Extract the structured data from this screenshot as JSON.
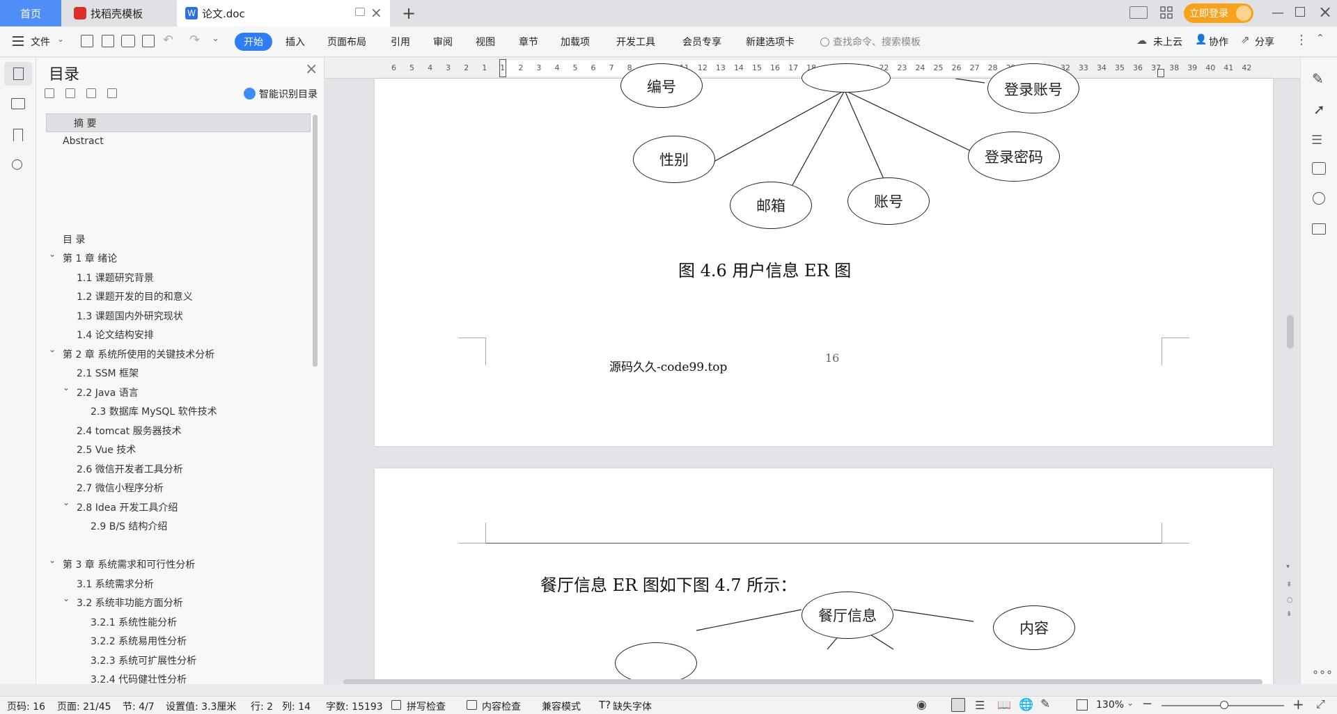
{
  "tabs": {
    "home": "首页",
    "template": "找稻壳模板",
    "doc": "论文.doc",
    "login": "立即登录"
  },
  "menu": {
    "file": "文件",
    "items": [
      "开始",
      "插入",
      "页面布局",
      "引用",
      "审阅",
      "视图",
      "章节",
      "加载项",
      "开发工具",
      "会员专享",
      "新建选项卡"
    ],
    "search_placeholder": "查找命令、搜索模板",
    "cloud": "未上云",
    "collab": "协作",
    "share": "分享"
  },
  "outline": {
    "title": "目录",
    "smart": "智能识别目录",
    "items": [
      {
        "label": "摘  要"
      },
      {
        "label": "Abstract"
      },
      {
        "label": "目  录"
      },
      {
        "label": "第 1 章  绪论"
      },
      {
        "label": "1.1    课题研究背景"
      },
      {
        "label": "1.2  课题开发的目的和意义"
      },
      {
        "label": "1.3    课题国内外研究现状"
      },
      {
        "label": "1.4  论文结构安排"
      },
      {
        "label": "第 2 章  系统所使用的关键技术分析"
      },
      {
        "label": "2.1 SSM 框架"
      },
      {
        "label": "2.2 Java 语言"
      },
      {
        "label": "2.3  数据库 MySQL 软件技术"
      },
      {
        "label": "2.4 tomcat 服务器技术"
      },
      {
        "label": "2.5 Vue 技术"
      },
      {
        "label": "2.6  微信开发者工具分析"
      },
      {
        "label": "2.7 微信小程序分析"
      },
      {
        "label": "2.8 Idea 开发工具介绍"
      },
      {
        "label": "2.9 B/S 结构介绍"
      },
      {
        "label": "第 3 章  系统需求和可行性分析"
      },
      {
        "label": "3.1 系统需求分析"
      },
      {
        "label": "3.2 系统非功能方面分析"
      },
      {
        "label": "3.2.1 系统性能分析"
      },
      {
        "label": "3.2.2 系统易用性分析"
      },
      {
        "label": "3.2.3 系统可扩展性分析"
      },
      {
        "label": "3.2.4 代码健壮性分析"
      }
    ]
  },
  "ruler": {
    "ticks": [
      "6",
      "5",
      "4",
      "3",
      "2",
      "1",
      "1",
      "2",
      "3",
      "4",
      "5",
      "6",
      "7",
      "8",
      "9",
      "10",
      "11",
      "12",
      "13",
      "14",
      "15",
      "16",
      "17",
      "18",
      "19",
      "20",
      "21",
      "22",
      "23",
      "24",
      "25",
      "26",
      "27",
      "28",
      "29",
      "30",
      "31",
      "32",
      "33",
      "34",
      "35",
      "36",
      "37",
      "38",
      "39",
      "40",
      "41",
      "42"
    ]
  },
  "page1": {
    "nodes": {
      "no": "编号",
      "account_login": "登录账号",
      "gender": "性别",
      "password": "登录密码",
      "email": "邮箱",
      "account": "账号"
    },
    "caption": "图 4.6 用户信息 ER 图",
    "footer_left": "源码久久-code99.top",
    "page_number": "16"
  },
  "page2": {
    "text": "餐厅信息 ER 图如下图 4.7 所示：",
    "nodes": {
      "center": "餐厅信息",
      "content": "内容"
    }
  },
  "status": {
    "page": "页码: 16",
    "pages": "页面: 21/45",
    "section": "节: 4/7",
    "setting": "设置值: 3.3厘米",
    "row": "行: 2",
    "col": "列: 14",
    "words": "字数: 15193",
    "spell": "拼写检查",
    "content_check": "内容检查",
    "compat": "兼容模式",
    "missing_font": "缺失字体",
    "zoom": "130%"
  },
  "colors": {
    "accent": "#2e7cf6",
    "login": "#f7a21b",
    "wps_red": "#d9302b"
  }
}
